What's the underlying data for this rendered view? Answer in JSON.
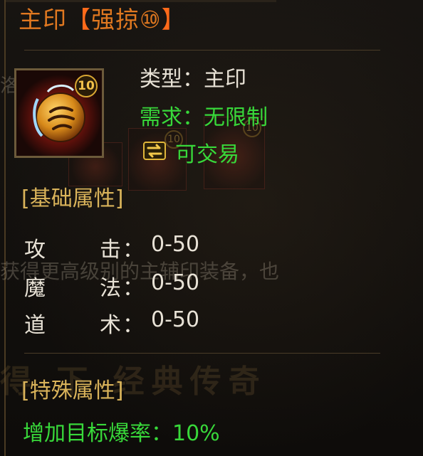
{
  "item": {
    "title_main": "主印",
    "title_bracket_open": "【",
    "title_suffix": "强掠⑩",
    "title_bracket_close": "】",
    "level_badge": "10",
    "type_label": "类型：",
    "type_value": "主印",
    "requirement_label": "需求：",
    "requirement_value": "无限制",
    "tradable": "可交易",
    "icon": "seal-orb-icon"
  },
  "base_attributes": {
    "title": "[基础属性]",
    "rows": [
      {
        "char1": "攻",
        "char2": "击",
        "colon": "：",
        "value": "0-50"
      },
      {
        "char1": "魔",
        "char2": "法",
        "colon": "：",
        "value": "0-50"
      },
      {
        "char1": "道",
        "char2": "术",
        "colon": "：",
        "value": "0-50"
      }
    ]
  },
  "special_attributes": {
    "title": "[特殊属性]",
    "text": "增加目标爆率：10%"
  },
  "background": {
    "left_char": "洛",
    "overlay_text": "获得更高级别的主辅印装备，也",
    "watermark": "得  下  经典传奇",
    "ghost_badges": [
      "10",
      "10"
    ]
  },
  "colors": {
    "title": "#e07820",
    "green": "#38d83a",
    "section_gold": "#d9b35a",
    "text": "#e8e2d6"
  }
}
